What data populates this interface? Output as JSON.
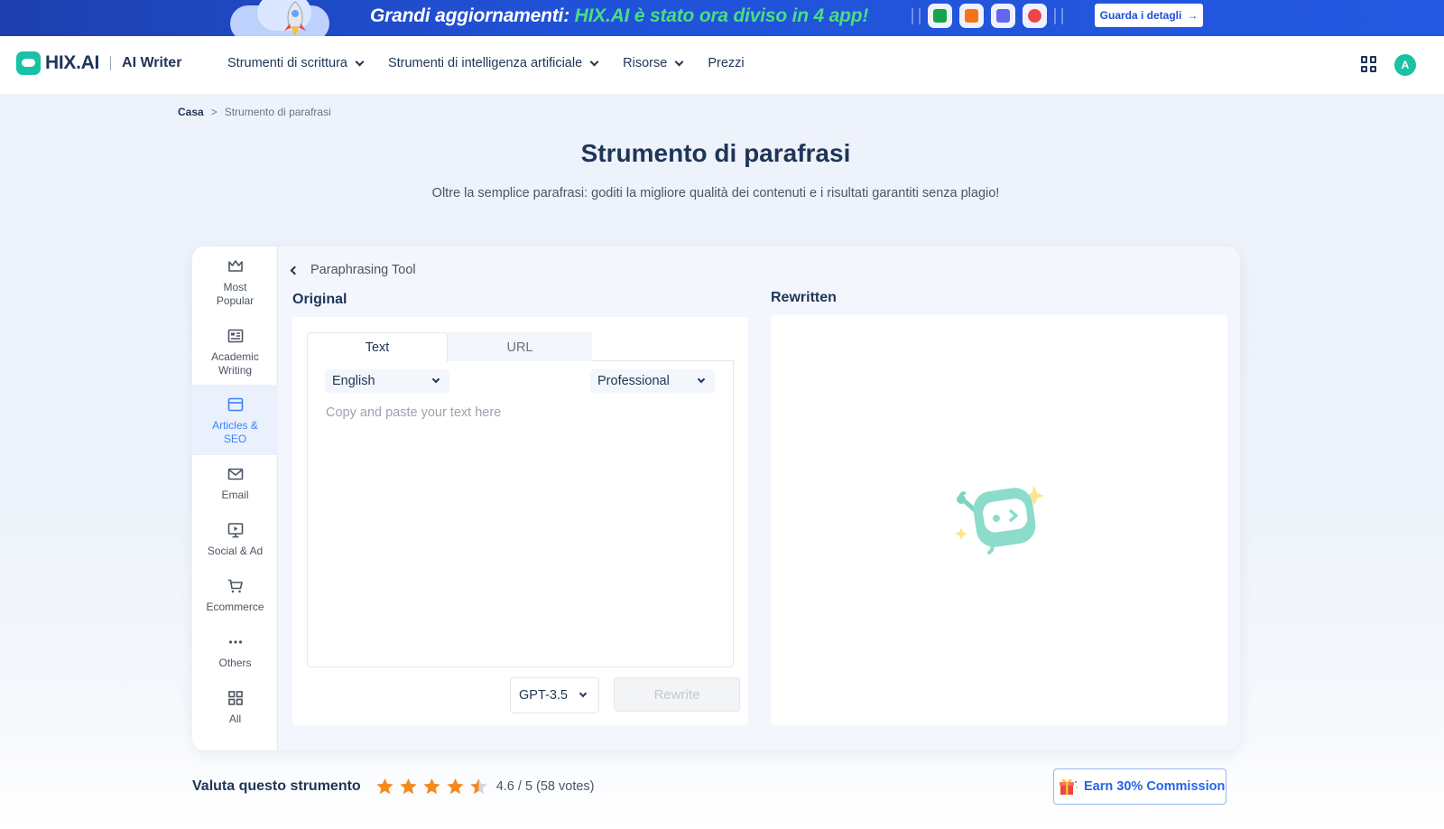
{
  "banner": {
    "headline_prefix": "Grandi aggiornamenti: ",
    "headline_highlight": "HIX.AI è stato ora diviso in 4 app!",
    "cta_label": "Guarda i detagli",
    "colors": {
      "background": "#2052d8",
      "highlight": "#4ade80"
    }
  },
  "header": {
    "brand": "HIX.AI",
    "product": "AI Writer",
    "nav": [
      {
        "label": "Strumenti di scrittura",
        "dropdown": true
      },
      {
        "label": "Strumenti di intelligenza artificiale",
        "dropdown": true
      },
      {
        "label": "Risorse",
        "dropdown": true
      },
      {
        "label": "Prezzi",
        "dropdown": false
      }
    ],
    "avatar_initial": "A"
  },
  "breadcrumb": {
    "home": "Casa",
    "separator": ">",
    "current": "Strumento di parafrasi"
  },
  "page": {
    "title": "Strumento di parafrasi",
    "subtitle": "Oltre la semplice parafrasi: goditi la migliore qualità dei contenuti e i risultati garantiti senza plagio!"
  },
  "sidebar": {
    "items": [
      {
        "label_line1": "Most",
        "label_line2": "Popular",
        "icon": "crown-icon",
        "active": false
      },
      {
        "label_line1": "Academic",
        "label_line2": "Writing",
        "icon": "newspaper-icon",
        "active": false
      },
      {
        "label_line1": "Articles &",
        "label_line2": "SEO",
        "icon": "browser-icon",
        "active": true
      },
      {
        "label_line1": "Email",
        "label_line2": "",
        "icon": "mail-icon",
        "active": false
      },
      {
        "label_line1": "Social & Ad",
        "label_line2": "",
        "icon": "presentation-icon",
        "active": false
      },
      {
        "label_line1": "Ecommerce",
        "label_line2": "",
        "icon": "cart-icon",
        "active": false
      },
      {
        "label_line1": "Others",
        "label_line2": "",
        "icon": "more-icon",
        "active": false
      },
      {
        "label_line1": "All",
        "label_line2": "",
        "icon": "grid-icon",
        "active": false
      }
    ]
  },
  "tool": {
    "back_label": "Paraphrasing Tool",
    "original_title": "Original",
    "rewritten_title": "Rewritten",
    "tabs": [
      {
        "label": "Text",
        "active": true
      },
      {
        "label": "URL",
        "active": false
      }
    ],
    "language": "English",
    "tone": "Professional",
    "placeholder": "Copy and paste your text here",
    "model": "GPT-3.5",
    "rewrite_label": "Rewrite"
  },
  "rating": {
    "label": "Valuta questo strumento",
    "score_text": "4.6 / 5 (58 votes)",
    "stars": 4.6,
    "star_color": "#f58a1f"
  },
  "earn": {
    "label": "Earn 30% Commission"
  }
}
